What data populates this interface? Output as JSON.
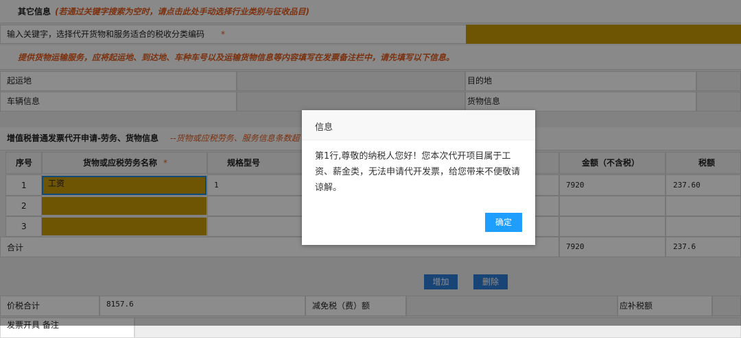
{
  "other_info": {
    "title": "其它信息",
    "hint": "(若通过关键字搜索为空时，请点击此处手动选择行业类别与征收品目)"
  },
  "keyword": {
    "label": "输入关键字，选择代开货物和服务适合的税收分类编码",
    "required_mark": "*"
  },
  "transport_hint": "提供货物运输服务，应将起运地、到达地、车种车号以及运输货物信息等内容填写在发票备注栏中，请先填写以下信息。",
  "transport": {
    "origin_label": "起运地",
    "destination_label": "目的地",
    "vehicle_label": "车辆信息",
    "cargo_label": "货物信息"
  },
  "goods_section": {
    "title": "增值税普通发票代开申请-劳务、货物信息",
    "hint": "--货物或应税劳务、服务信息条数超"
  },
  "table": {
    "headers": {
      "seq": "序号",
      "name": "货物或应税劳务名称",
      "name_required": "*",
      "spec": "规格型号",
      "amount": "金额（不含税）",
      "tax": "税额"
    },
    "rows": [
      {
        "seq": "1",
        "name": "工资",
        "spec": "1",
        "amount": "7920",
        "tax": "237.60"
      },
      {
        "seq": "2",
        "name": "",
        "spec": "",
        "amount": "",
        "tax": ""
      },
      {
        "seq": "3",
        "name": "",
        "spec": "",
        "amount": "",
        "tax": ""
      }
    ],
    "total": {
      "label": "合计",
      "amount": "7920",
      "tax": "237.6"
    }
  },
  "buttons": {
    "add": "增加",
    "delete": "删除"
  },
  "summary": {
    "total_label": "价税合计",
    "total_value": "8157.6",
    "exempt_label": "减免税（费）额",
    "supplement_label": "应补税额"
  },
  "remarks_label": "发票开具 备注",
  "dialog": {
    "title": "信息",
    "message": "第1行,尊敬的纳税人您好！您本次代开项目属于工资、薪金类，无法申请代开发票，给您带来不便敬请谅解。",
    "ok": "确定"
  },
  "colors": {
    "highlight": "#c99b09",
    "hint": "#e05a1c",
    "button": "#2f7fd8",
    "dialog_button": "#1e9fff"
  }
}
